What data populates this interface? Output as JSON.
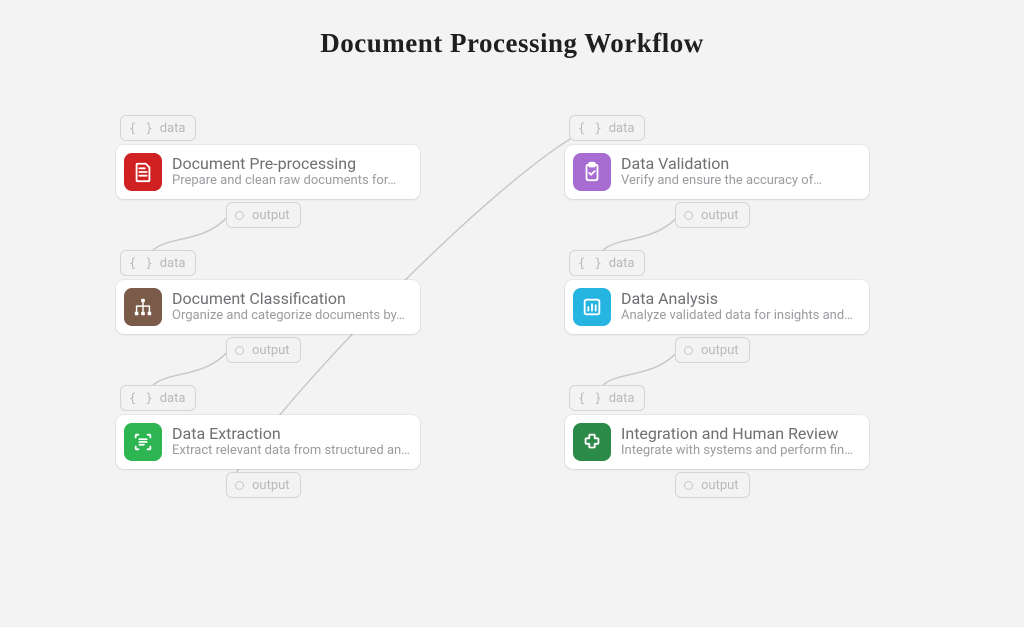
{
  "title": "Document Processing Workflow",
  "labels": {
    "data": "data",
    "output": "output"
  },
  "nodes": {
    "n1": {
      "title": "Document Pre-processing",
      "desc": "Prepare and clean raw documents for…"
    },
    "n2": {
      "title": "Document Classification",
      "desc": "Organize and categorize documents by…"
    },
    "n3": {
      "title": "Data Extraction",
      "desc": "Extract relevant data from structured an…"
    },
    "n4": {
      "title": "Data Validation",
      "desc": "Verify and ensure the accuracy of…"
    },
    "n5": {
      "title": "Data Analysis",
      "desc": "Analyze validated data for insights and…"
    },
    "n6": {
      "title": "Integration and Human Review",
      "desc": "Integrate with systems and perform fina…"
    }
  },
  "colors": {
    "bg": "#f3f3f4",
    "card": "#ffffff",
    "text_primary": "#6f6f74",
    "text_secondary": "#9b9ba0",
    "pill_text": "#b9b9bc",
    "icons": {
      "n1": "#cf2022",
      "n2": "#7a5a49",
      "n3": "#2db552",
      "n4": "#a66cd1",
      "n5": "#26b4e0",
      "n6": "#2b8a47"
    }
  }
}
